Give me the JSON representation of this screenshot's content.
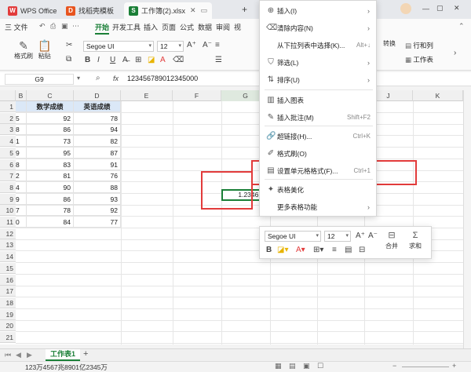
{
  "titlebar": {
    "tabs": [
      {
        "label": "WPS Office"
      },
      {
        "label": "找稻壳模板"
      },
      {
        "label": "工作簿(2).xlsx"
      }
    ],
    "add_label": "+"
  },
  "menubar": {
    "file_label": "三 文件",
    "tabs": [
      "开始",
      "开发工具",
      "插入",
      "页面",
      "公式",
      "数据",
      "审阅"
    ]
  },
  "ribbon": {
    "format_painter": "格式刷",
    "paste": "粘贴",
    "font_name": "Segoe UI",
    "font_size": "12",
    "convert": "转换",
    "rows_cols": "行和列",
    "worksheet": "工作表"
  },
  "formula_bar": {
    "name_box": "G9",
    "fx": "fx",
    "content": "123456789012345000"
  },
  "grid": {
    "columns": [
      "B",
      "C",
      "D",
      "E",
      "F",
      "G",
      "H",
      "I",
      "J",
      "K"
    ],
    "rows": [
      "1",
      "2",
      "3",
      "4",
      "5",
      "6",
      "7",
      "8",
      "9",
      "10",
      "11",
      "12",
      "13",
      "14",
      "15",
      "16",
      "17",
      "18",
      "19",
      "20",
      "21"
    ],
    "header_c": "数学成绩",
    "header_d": "英语成绩",
    "b_values": [
      "5",
      "8",
      "1",
      "9",
      "8",
      "2",
      "4",
      "9",
      "7",
      "0"
    ],
    "c_values": [
      "92",
      "86",
      "73",
      "95",
      "83",
      "81",
      "90",
      "86",
      "78",
      "84"
    ],
    "d_values": [
      "78",
      "94",
      "82",
      "87",
      "91",
      "76",
      "88",
      "93",
      "92",
      "77"
    ],
    "g9_value": "1.2346E+"
  },
  "context_menu": {
    "items": [
      {
        "label": "插入(I)",
        "shortcut": "",
        "icon": "insert-icon"
      },
      {
        "label": "清除内容(N)",
        "shortcut": "",
        "icon": "clear-icon"
      },
      {
        "label": "从下拉列表中选择(K)...",
        "shortcut": "Alt+↓",
        "icon": ""
      },
      {
        "label": "筛选(L)",
        "shortcut": "",
        "icon": "filter-icon"
      },
      {
        "label": "排序(U)",
        "shortcut": "",
        "icon": "sort-icon"
      },
      {
        "label": "插入图表",
        "shortcut": "",
        "icon": "chart-icon"
      },
      {
        "label": "插入批注(M)",
        "shortcut": "Shift+F2",
        "icon": "comment-icon"
      },
      {
        "label": "超链接(H)...",
        "shortcut": "Ctrl+K",
        "icon": "link-icon"
      },
      {
        "label": "格式刷(O)",
        "shortcut": "",
        "icon": "brush-icon"
      },
      {
        "label": "设置单元格格式(F)...",
        "shortcut": "Ctrl+1",
        "icon": "format-cells-icon"
      },
      {
        "label": "表格美化",
        "shortcut": "",
        "icon": "beautify-icon"
      },
      {
        "label": "更多表格功能",
        "shortcut": "",
        "icon": ""
      }
    ]
  },
  "mini_toolbar": {
    "font_name": "Segoe UI",
    "font_size": "12",
    "merge": "合并",
    "sum": "求和"
  },
  "sheetbar": {
    "sheet_tab": "工作表1",
    "add": "+"
  },
  "statusbar": {
    "text": "123万4567兆8901亿2345万"
  },
  "colors": {
    "accent_green": "#1a7f37",
    "highlight_red": "#e23b3b",
    "header_fill": "#dbe8f7"
  }
}
